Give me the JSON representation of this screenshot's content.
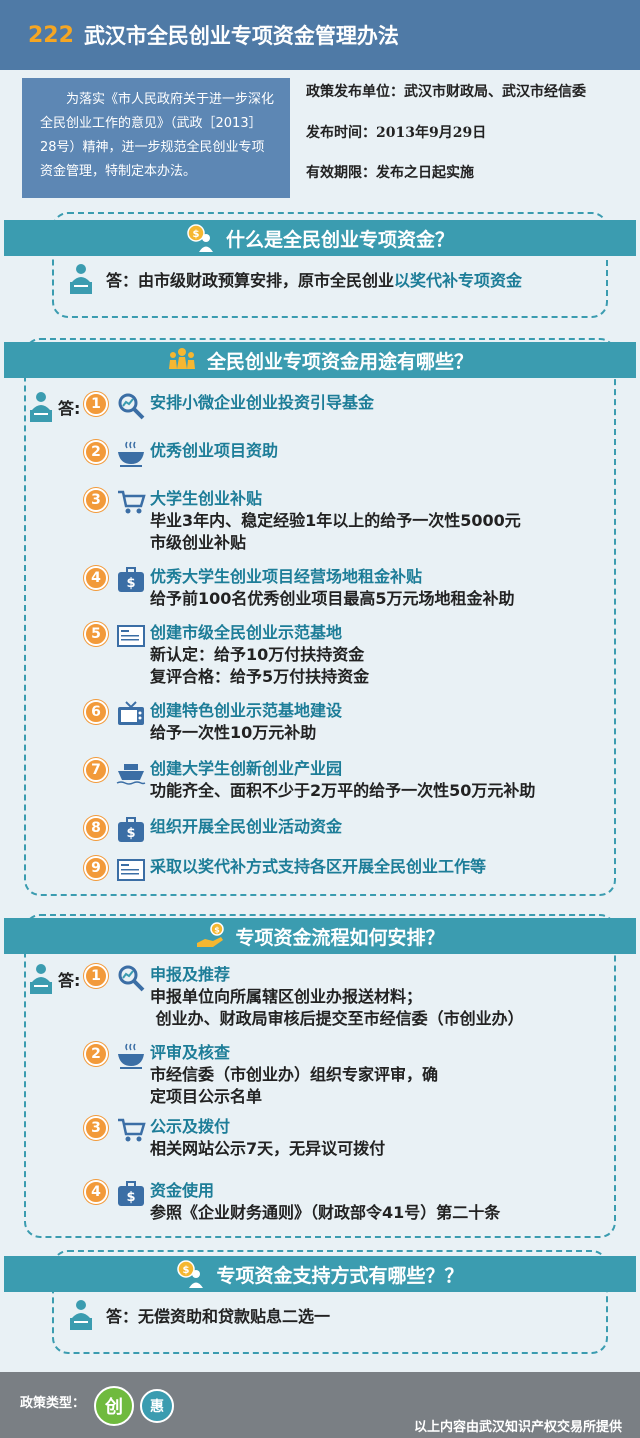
{
  "header": {
    "number": "222",
    "title": "武汉市全民创业专项资金管理办法"
  },
  "intro": "为落实《市人民政府关于进一步深化全民创业工作的意见》（武政［2013］28号）精神，进一步规范全民创业专项资金管理，特制定本办法。",
  "meta": {
    "unit": "政策发布单位：武汉市财政局、武汉市经信委",
    "date": "发布时间：2013年9月29日",
    "validity": "有效期限：发布之日起实施"
  },
  "section1": {
    "title": "什么是全民创业专项资金？",
    "answer_prefix": "答：由市级财政预算安排，原市全民创业",
    "answer_highlight": "以奖代补专项资金"
  },
  "section2": {
    "title": "全民创业专项资金用途有哪些？",
    "answer_label": "答:",
    "items": [
      {
        "num": "1",
        "title": "安排小微企业创业投资引导基金",
        "desc": []
      },
      {
        "num": "2",
        "title": "优秀创业项目资助",
        "desc": []
      },
      {
        "num": "3",
        "title": "大学生创业补贴",
        "desc": [
          "毕业3年内、稳定经验1年以上的给予一次性5000元",
          "市级创业补贴"
        ]
      },
      {
        "num": "4",
        "title": "优秀大学生创业项目经营场地租金补贴",
        "desc": [
          "给予前100名优秀创业项目最高5万元场地租金补助"
        ]
      },
      {
        "num": "5",
        "title": "创建市级全民创业示范基地",
        "desc": [
          "新认定：给予10万付扶持资金",
          "复评合格：给予5万付扶持资金"
        ]
      },
      {
        "num": "6",
        "title": "创建特色创业示范基地建设",
        "desc": [
          "给予一次性10万元补助"
        ]
      },
      {
        "num": "7",
        "title": "创建大学生创新创业产业园",
        "desc": [
          "功能齐全、面积不少于2万平的给予一次性50万元补助"
        ]
      },
      {
        "num": "8",
        "title": "组织开展全民创业活动资金",
        "desc": []
      },
      {
        "num": "9",
        "title": "采取以奖代补方式支持各区开展全民创业工作等",
        "desc": []
      }
    ]
  },
  "section3": {
    "title": "专项资金流程如何安排？",
    "answer_label": "答:",
    "items": [
      {
        "num": "1",
        "title": "申报及推荐",
        "desc": [
          "申报单位向所属辖区创业办报送材料；",
          " 创业办、财政局审核后提交至市经信委（市创业办）"
        ]
      },
      {
        "num": "2",
        "title": "评审及核查",
        "desc": [
          "市经信委（市创业办）组织专家评审，确",
          "定项目公示名单"
        ]
      },
      {
        "num": "3",
        "title": "公示及拨付",
        "desc": [
          "相关网站公示7天，无异议可拨付"
        ]
      },
      {
        "num": "4",
        "title": "资金使用",
        "desc": [
          "参照《企业财务通则》（财政部令41号）第二十条"
        ]
      }
    ]
  },
  "section4": {
    "title": "专项资金支持方式有哪些？？",
    "answer": "答：无偿资助和贷款贴息二选一"
  },
  "footer": {
    "label": "政策类型：",
    "type1": "创",
    "type2": "惠",
    "credit": "以上内容由武汉知识产权交易所提供"
  },
  "colors": {
    "header": "#4f7aa6",
    "bar": "#3b9cb0",
    "badge": "#f29a3a",
    "highlight": "#1d7d98"
  }
}
